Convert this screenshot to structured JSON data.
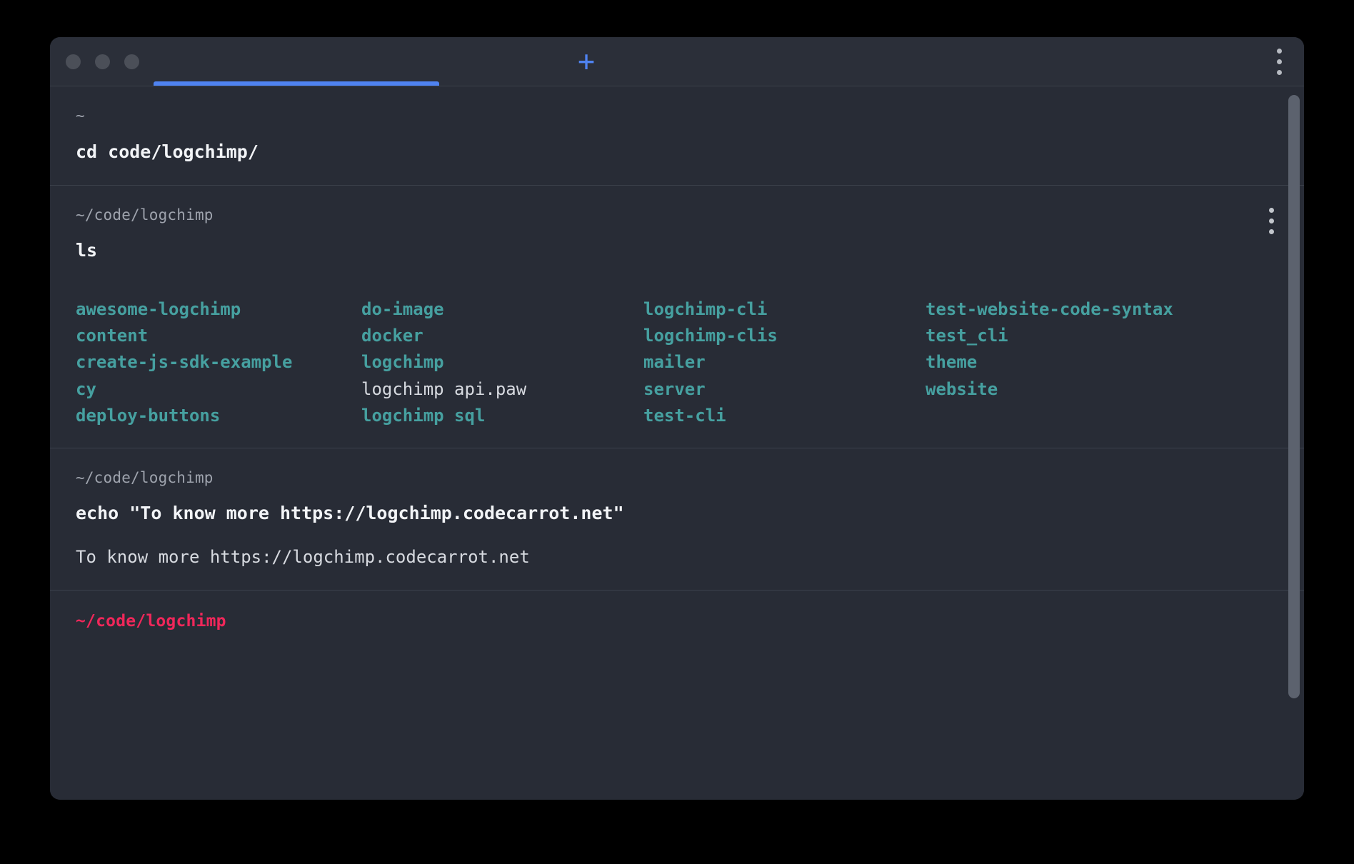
{
  "window": {
    "traffic_lights": [
      "close",
      "minimize",
      "maximize"
    ],
    "new_tab_label": "+",
    "tab_label": "",
    "accent_color": "#4f83f1",
    "background_color": "#282c36",
    "menu_icon": "kebab-menu-icon"
  },
  "blocks": [
    {
      "id": "block-cd",
      "prompt_path": "~",
      "command": "cd code/logchimp/",
      "output": null
    },
    {
      "id": "block-ls",
      "prompt_path": "~/code/logchimp",
      "command": "ls",
      "has_menu": true,
      "ls_columns": [
        [
          {
            "name": "awesome-logchimp",
            "type": "dir"
          },
          {
            "name": "content",
            "type": "dir"
          },
          {
            "name": "create-js-sdk-example",
            "type": "dir"
          },
          {
            "name": "cy",
            "type": "dir"
          },
          {
            "name": "deploy-buttons",
            "type": "dir"
          }
        ],
        [
          {
            "name": "do-image",
            "type": "dir"
          },
          {
            "name": "docker",
            "type": "dir"
          },
          {
            "name": "logchimp",
            "type": "dir"
          },
          {
            "name": "logchimp api.paw",
            "type": "file"
          },
          {
            "name": "logchimp sql",
            "type": "dir"
          }
        ],
        [
          {
            "name": "logchimp-cli",
            "type": "dir"
          },
          {
            "name": "logchimp-clis",
            "type": "dir"
          },
          {
            "name": "mailer",
            "type": "dir"
          },
          {
            "name": "server",
            "type": "dir"
          },
          {
            "name": "test-cli",
            "type": "dir"
          }
        ],
        [
          {
            "name": "test-website-code-syntax",
            "type": "dir"
          },
          {
            "name": "test_cli",
            "type": "dir"
          },
          {
            "name": "theme",
            "type": "dir"
          },
          {
            "name": "website",
            "type": "dir"
          }
        ]
      ]
    },
    {
      "id": "block-echo",
      "prompt_path": "~/code/logchimp",
      "command": "echo \"To know more https://logchimp.codecarrot.net\"",
      "output": "To know more https://logchimp.codecarrot.net"
    },
    {
      "id": "block-active",
      "prompt_path": "~/code/logchimp",
      "command": "",
      "output": null
    }
  ],
  "colors": {
    "directory": "#46a0a0",
    "file": "#d7dae0",
    "active_prompt": "#f0275a",
    "command_text": "#f2f4f7",
    "prompt_path": "#9ea3ad"
  }
}
